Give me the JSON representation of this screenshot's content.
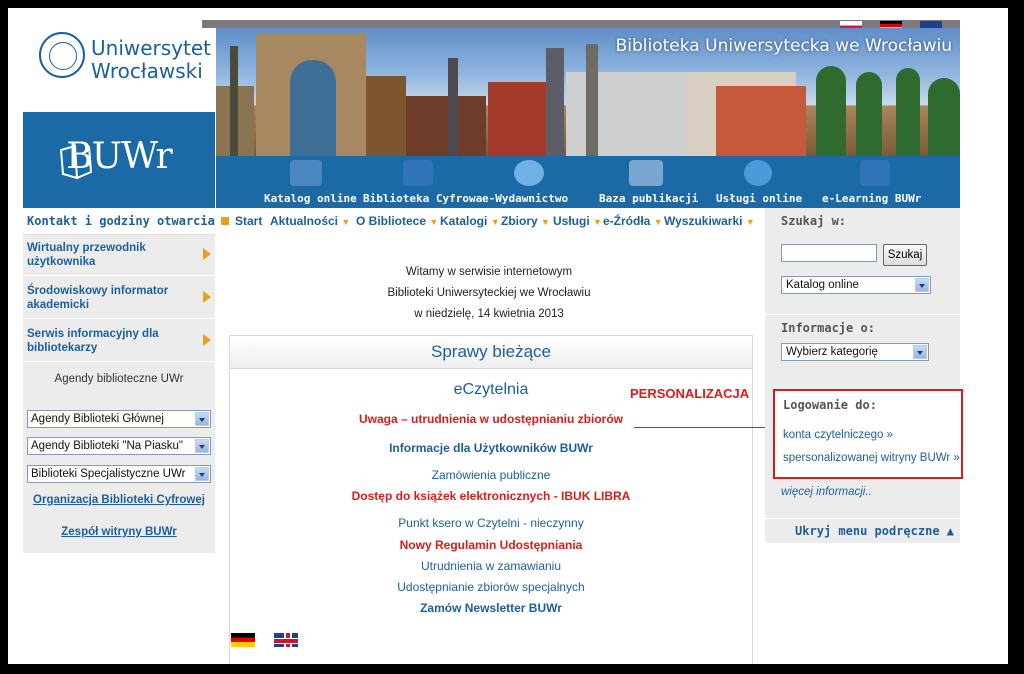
{
  "header": {
    "university_line1": "Uniwersytet",
    "university_line2": "Wrocławski",
    "library_logo": "BUWr",
    "banner_title": "Biblioteka Uniwersytecka we Wrocławiu"
  },
  "nav_icons": [
    {
      "label": "Katalog online",
      "icon": "printer-icon"
    },
    {
      "label": "Biblioteka Cyfrowa",
      "icon": "computer-icon"
    },
    {
      "label": "e-Wydawnictwo",
      "icon": "cd-icon"
    },
    {
      "label": "Baza publikacji",
      "icon": "book-icon"
    },
    {
      "label": "Usługi online",
      "icon": "globe-icon"
    },
    {
      "label": "e-Learning BUWr",
      "icon": "graduation-cap-icon"
    }
  ],
  "menu": {
    "contact": "Kontakt i godziny otwarcia",
    "items": [
      "Start",
      "Aktualności",
      "O Bibliotece",
      "Katalogi",
      "Zbiory",
      "Usługi",
      "e-Źródła",
      "Wyszukiwarki"
    ]
  },
  "left_sidebar": {
    "items": [
      "Wirtualny przewodnik użytkownika",
      "Środowiskowy informator akademicki",
      "Serwis informacyjny dla bibliotekarzy"
    ],
    "agendy_label": "Agendy biblioteczne UWr",
    "selects": [
      "Agendy Biblioteki Głównej",
      "Agendy Biblioteki \"Na Piasku\"",
      "Biblioteki Specjalistyczne UWr"
    ],
    "links": [
      "Organizacja Biblioteki Cyfrowej",
      "Zespół witryny BUWr"
    ]
  },
  "welcome": {
    "line1": "Witamy w serwisie internetowym",
    "line2": "Biblioteki Uniwersyteckiej we Wrocławiu",
    "line3": "w niedzielę, 14 kwietnia 2013"
  },
  "main": {
    "section_title": "Sprawy bieżące",
    "eczytelnia": "eCzytelnia",
    "personalizacja": "PERSONALIZACJA",
    "links": [
      "Uwaga – utrudnienia w udostępnianiu zbiorów",
      "Informacje dla Użytkowników BUWr",
      "Zamówienia publiczne",
      "Dostęp do książek elektronicznych - IBUK LIBRA",
      "Punkt ksero w Czytelni - nieczynny",
      "Nowy Regulamin Udostępniania",
      "Utrudnienia w zamawianiu",
      "Udostępnianie zbiorów specjalnych",
      "Zamów Newsletter BUWr"
    ]
  },
  "right_sidebar": {
    "search_heading": "Szukaj w:",
    "search_value": "",
    "search_button": "Szukaj",
    "search_select": "Katalog online",
    "info_heading": "Informacje o:",
    "info_select": "Wybierz kategorię",
    "login_heading": "Logowanie do:",
    "login_link1": "konta czytelniczego »",
    "login_link2": "spersonalizowanej witryny BUWr »",
    "more_info": "więcej informacji..",
    "hide_menu": "Ukryj menu podręczne ▲"
  },
  "colors": {
    "brand_blue": "#1b6aa5",
    "link_blue": "#1c5f9c",
    "accent_orange": "#e3a21a",
    "alert_red": "#e01a1a"
  }
}
